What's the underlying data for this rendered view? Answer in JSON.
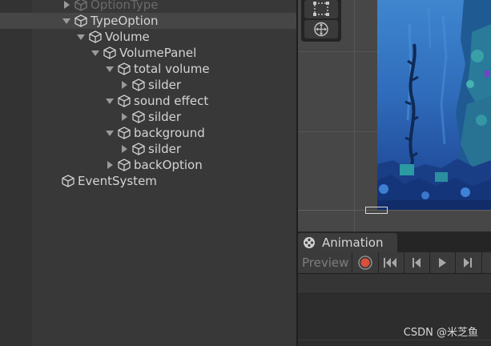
{
  "hierarchy": {
    "items": [
      {
        "label": "OptionType",
        "depth": 0,
        "arrow": "right",
        "ghost": true
      },
      {
        "label": "TypeOption",
        "depth": 0,
        "arrow": "down",
        "selected": true
      },
      {
        "label": "Volume",
        "depth": 1,
        "arrow": "down"
      },
      {
        "label": "VolumePanel",
        "depth": 2,
        "arrow": "down"
      },
      {
        "label": "total volume",
        "depth": 3,
        "arrow": "down"
      },
      {
        "label": "silder",
        "depth": 4,
        "arrow": "right"
      },
      {
        "label": "sound effect",
        "depth": 3,
        "arrow": "down"
      },
      {
        "label": "silder",
        "depth": 4,
        "arrow": "right"
      },
      {
        "label": "background",
        "depth": 3,
        "arrow": "down"
      },
      {
        "label": "silder",
        "depth": 4,
        "arrow": "right"
      },
      {
        "label": "backOption",
        "depth": 3,
        "arrow": "right"
      },
      {
        "label": "EventSystem",
        "depth": -1,
        "arrow": "none"
      }
    ]
  },
  "scene": {
    "tools": [
      "rect-tool-icon",
      "transform-tool-icon"
    ]
  },
  "animation": {
    "tab_label": "Animation",
    "preview_label": "Preview",
    "controls": [
      "record-icon",
      "first-keyframe-icon",
      "previous-keyframe-icon",
      "play-icon",
      "next-keyframe-icon"
    ]
  },
  "watermark": "CSDN @米芝鱼",
  "colors": {
    "panel_bg": "#383838",
    "selected_row": "#464646",
    "record_red": "#d9503b",
    "sky_blue": "#3b7fc7",
    "deep_blue": "#1a3f8a"
  }
}
